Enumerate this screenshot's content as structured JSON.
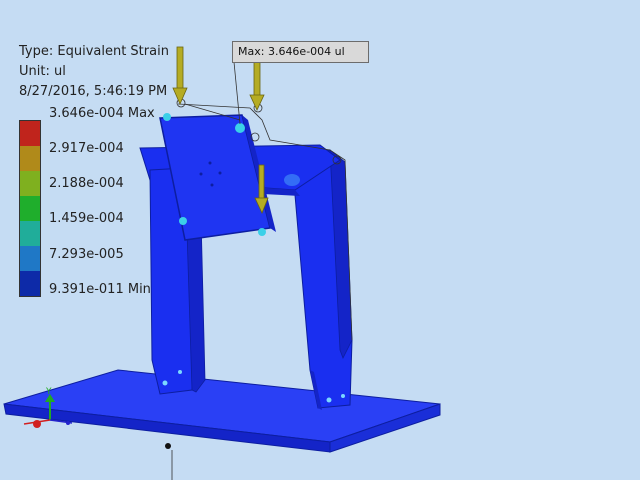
{
  "result_info": {
    "type_line": "Type: Equivalent Strain",
    "unit_line": "Unit: ul",
    "date_line": "8/27/2016, 5:46:19 PM"
  },
  "legend": {
    "colors": [
      "#c0241c",
      "#b08a1a",
      "#7fb01f",
      "#1fae2c",
      "#20ad9a",
      "#1f78c6",
      "#0d2aa8"
    ],
    "labels": [
      "3.646e-004 Max",
      "2.917e-004",
      "2.188e-004",
      "1.459e-004",
      "7.293e-005",
      "9.391e-011 Min"
    ]
  },
  "max_probe": {
    "label": "Max: 3.646e-004 ul"
  },
  "load_arrow_color": "#b5ac23",
  "model_color": "#1a2ff0",
  "axis_triad": {
    "y_label": "Y",
    "colors": {
      "x": "#d12020",
      "y": "#22aa22",
      "z": "#2222cc"
    }
  }
}
